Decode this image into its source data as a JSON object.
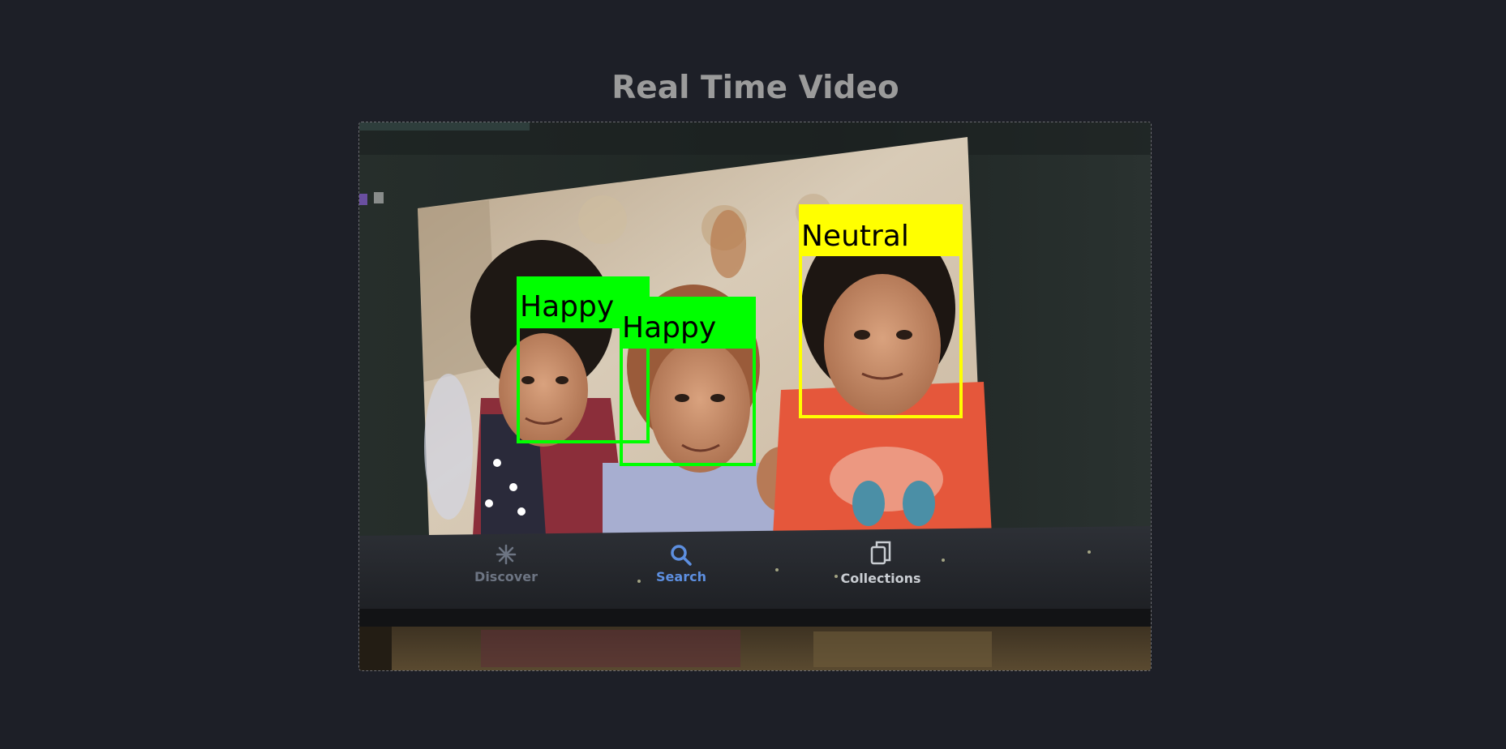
{
  "page": {
    "title": "Real Time Video"
  },
  "detections": [
    {
      "label": "Happy",
      "color": "#00ff00"
    },
    {
      "label": "Happy",
      "color": "#00ff00"
    },
    {
      "label": "Neutral",
      "color": "#ffff00"
    }
  ],
  "captured_screen_tabs": [
    {
      "icon": "sparkle-icon",
      "label": "Discover",
      "color": "#6d7583"
    },
    {
      "icon": "search-icon",
      "label": "Search",
      "color": "#5d8fe0"
    },
    {
      "icon": "collections-icon",
      "label": "Collections",
      "color": "#c9cdd2"
    }
  ]
}
